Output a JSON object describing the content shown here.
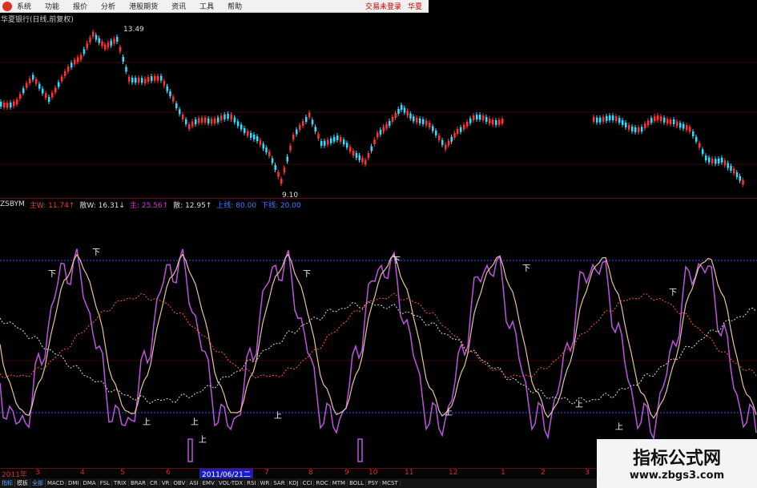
{
  "menubar": {
    "items": [
      "系统",
      "功能",
      "报价",
      "分析",
      "港股期货",
      "资讯",
      "工具",
      "帮助"
    ],
    "right": [
      "交易未登录",
      "华夏"
    ]
  },
  "stock": {
    "title": "华夏银行(日线,前复权)",
    "high_label": "13.49",
    "low_label": "9.10"
  },
  "indicator": {
    "name": "ZSBYM",
    "items": [
      {
        "label": "主W: 11.74↑",
        "color": "#ff3333"
      },
      {
        "label": "散W: 16.31↓",
        "color": "#dddddd"
      },
      {
        "label": "主: 25.56↑",
        "color": "#cc33cc"
      },
      {
        "label": "散: 12.95↑",
        "color": "#dddddd"
      },
      {
        "label": "上线: 80.00",
        "color": "#4477ff"
      },
      {
        "label": "下线: 20.00",
        "color": "#4477ff"
      }
    ]
  },
  "markers": {
    "down": "下",
    "up": "上"
  },
  "datebar": {
    "year": "2011年",
    "ticks": [
      "3",
      "4",
      "5",
      "6",
      "7",
      "8",
      "9",
      "10",
      "11",
      "12",
      "1",
      "2",
      "3"
    ],
    "selected": "2011/06/21二"
  },
  "tabs": [
    "指标",
    "模板",
    "全部",
    "MACD",
    "DMI",
    "DMA",
    "FSL",
    "TRIX",
    "BRAR",
    "CR",
    "VR",
    "OBV",
    "ASI",
    "EMV",
    "VOL-TDX",
    "RSI",
    "WR",
    "SAR",
    "KDJ",
    "CCI",
    "ROC",
    "MTM",
    "BOLL",
    "PSY",
    "MCST"
  ],
  "watermark": {
    "title": "指标公式网",
    "url": "www.zbgs3.com"
  },
  "colors": {
    "up": "#ff3333",
    "down": "#33ddff",
    "main": "#bb55dd",
    "retail": "#e8c29a",
    "trend": "#dddddd",
    "trend2": "#ff5544",
    "guide": "#3355ff"
  }
}
